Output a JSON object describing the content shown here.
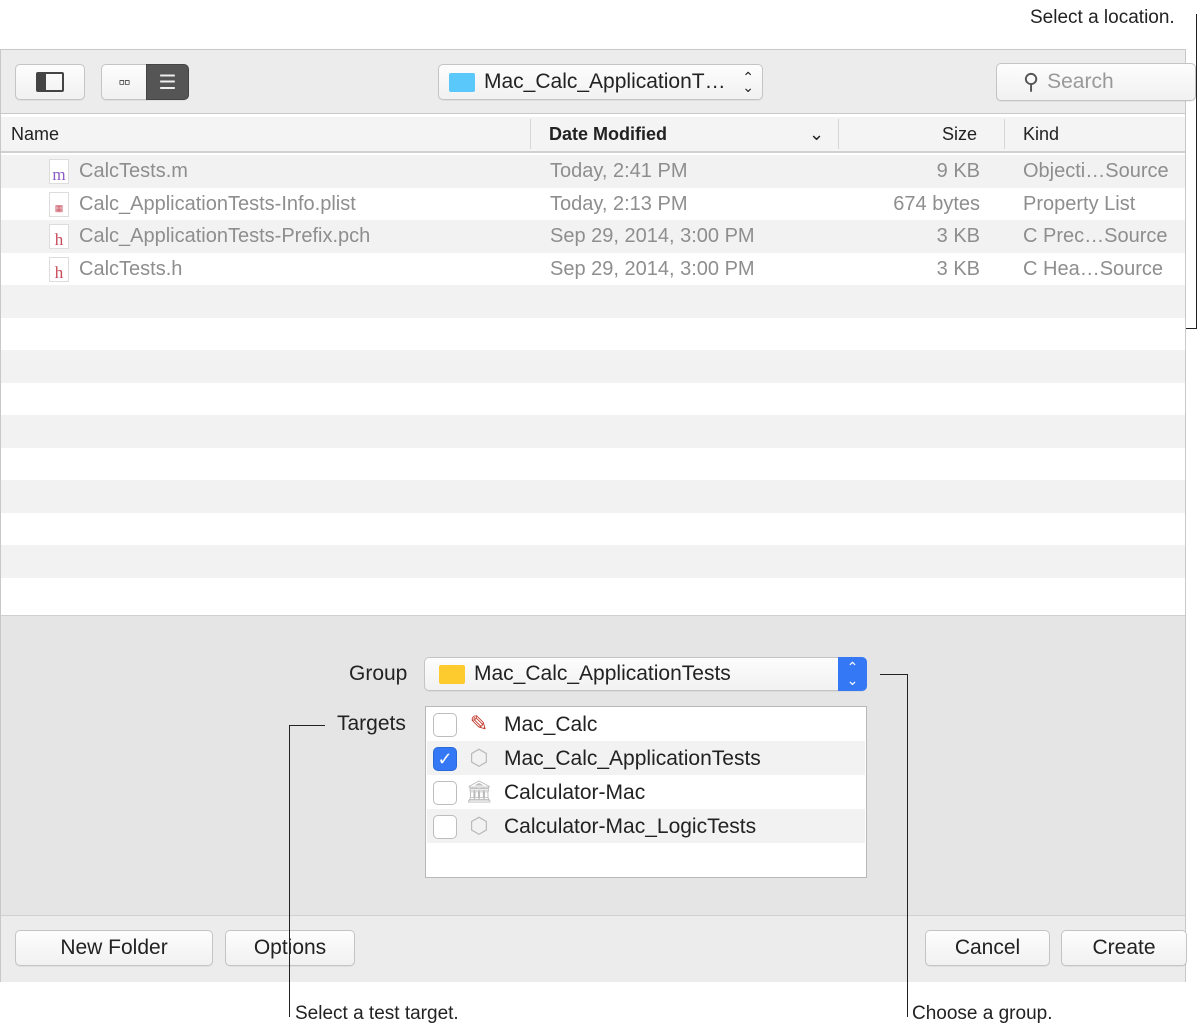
{
  "callouts": {
    "location": "Select a location.",
    "target": "Select a test target.",
    "group": "Choose a group."
  },
  "toolbar": {
    "path": "Mac_Calc_ApplicationT…",
    "search_placeholder": "Search"
  },
  "columns": {
    "name": "Name",
    "date": "Date Modified",
    "size": "Size",
    "kind": "Kind"
  },
  "files": [
    {
      "icon": "m",
      "name": "CalcTests.m",
      "date": "Today, 2:41 PM",
      "size": "9 KB",
      "kind": "Objecti…Source"
    },
    {
      "icon": "plist",
      "name": "Calc_ApplicationTests-Info.plist",
      "date": "Today, 2:13 PM",
      "size": "674 bytes",
      "kind": "Property List"
    },
    {
      "icon": "h",
      "name": "Calc_ApplicationTests-Prefix.pch",
      "date": "Sep 29, 2014, 3:00 PM",
      "size": "3 KB",
      "kind": "C Prec…Source"
    },
    {
      "icon": "h",
      "name": "CalcTests.h",
      "date": "Sep 29, 2014, 3:00 PM",
      "size": "3 KB",
      "kind": "C Hea…Source"
    }
  ],
  "group": {
    "label": "Group",
    "value": "Mac_Calc_ApplicationTests"
  },
  "targets": {
    "label": "Targets",
    "items": [
      {
        "name": "Mac_Calc",
        "checked": false,
        "icon": "app-icon"
      },
      {
        "name": "Mac_Calc_ApplicationTests",
        "checked": true,
        "icon": "test-bundle-icon"
      },
      {
        "name": "Calculator-Mac",
        "checked": false,
        "icon": "framework-icon"
      },
      {
        "name": "Calculator-Mac_LogicTests",
        "checked": false,
        "icon": "test-bundle-icon"
      }
    ]
  },
  "buttons": {
    "new_folder": "New Folder",
    "options": "Options",
    "cancel": "Cancel",
    "create": "Create"
  },
  "colors": {
    "accent": "#3478f6",
    "folder": "#5ac8fa",
    "group_folder": "#fdcb2e"
  }
}
